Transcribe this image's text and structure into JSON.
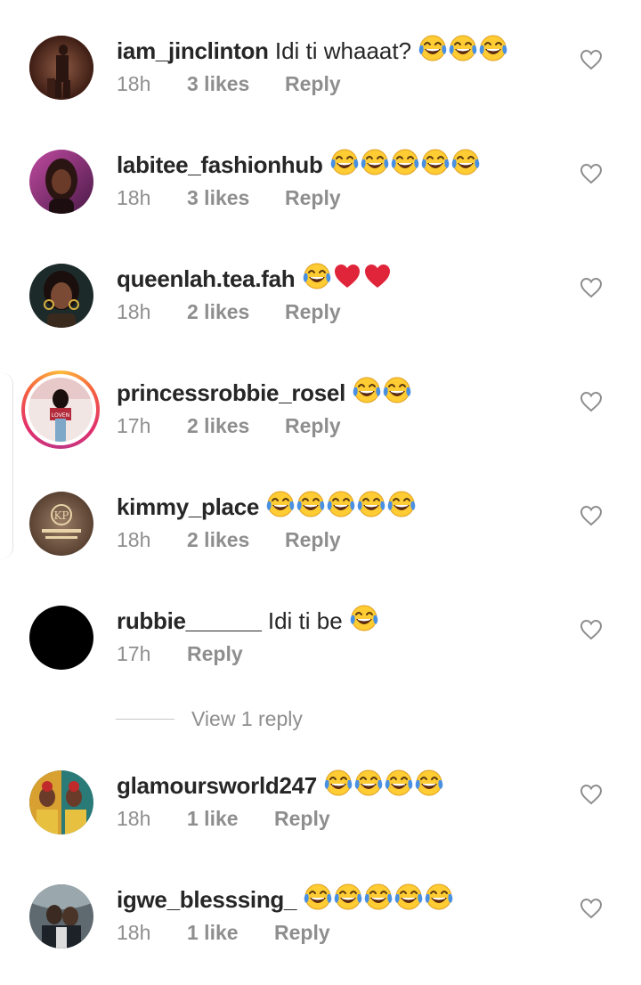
{
  "comments": [
    {
      "username": "iam_jinclinton",
      "text": "Idi ti whaaat?",
      "emojis": [
        "laugh-cry",
        "laugh-cry",
        "laugh-cry"
      ],
      "time": "18h",
      "likes": "3 likes",
      "reply": "Reply",
      "avatar_color": "#6b3b2c"
    },
    {
      "username": "labitee_fashionhub",
      "text": "",
      "emojis": [
        "laugh-cry",
        "laugh-cry",
        "laugh-cry",
        "laugh-cry",
        "laugh-cry"
      ],
      "time": "18h",
      "likes": "3 likes",
      "reply": "Reply",
      "avatar_color": "#7c2a6a"
    },
    {
      "username": "queenlah.tea.fah",
      "text": "",
      "emojis": [
        "laugh-cry",
        "red-heart",
        "red-heart"
      ],
      "time": "18h",
      "likes": "2 likes",
      "reply": "Reply",
      "avatar_color": "#3c2a22"
    },
    {
      "username": "princessrobbie_rosel",
      "text": "",
      "emojis": [
        "laugh-cry",
        "laugh-cry"
      ],
      "time": "17h",
      "likes": "2 likes",
      "reply": "Reply",
      "avatar_color": "#b32b3b",
      "has_story_ring": true
    },
    {
      "username": "kimmy_place",
      "text": "",
      "emojis": [
        "laugh-cry",
        "laugh-cry",
        "laugh-cry",
        "laugh-cry",
        "laugh-cry"
      ],
      "time": "18h",
      "likes": "2 likes",
      "reply": "Reply",
      "avatar_color": "#7a6250"
    },
    {
      "username": "rubbie______",
      "text": "Idi ti be",
      "emojis": [
        "laugh-cry"
      ],
      "time": "17h",
      "likes": "",
      "reply": "Reply",
      "avatar_color": "#000000"
    },
    {
      "username": "glamoursworld247",
      "text": "",
      "emojis": [
        "laugh-cry",
        "laugh-cry",
        "laugh-cry",
        "laugh-cry"
      ],
      "time": "18h",
      "likes": "1 like",
      "reply": "Reply",
      "avatar_color": "#c89a2c"
    },
    {
      "username": "igwe_blesssing_",
      "text": "",
      "emojis": [
        "laugh-cry",
        "laugh-cry",
        "laugh-cry",
        "laugh-cry",
        "laugh-cry"
      ],
      "time": "18h",
      "likes": "1 like",
      "reply": "Reply",
      "avatar_color": "#4a5560"
    }
  ],
  "view_replies": "View 1 reply",
  "colors": {
    "text": "#262626",
    "meta": "#8e8e8e",
    "emoji_face": "#ffcc33",
    "emoji_tear": "#4a90e2",
    "heart": "#e0243a"
  }
}
